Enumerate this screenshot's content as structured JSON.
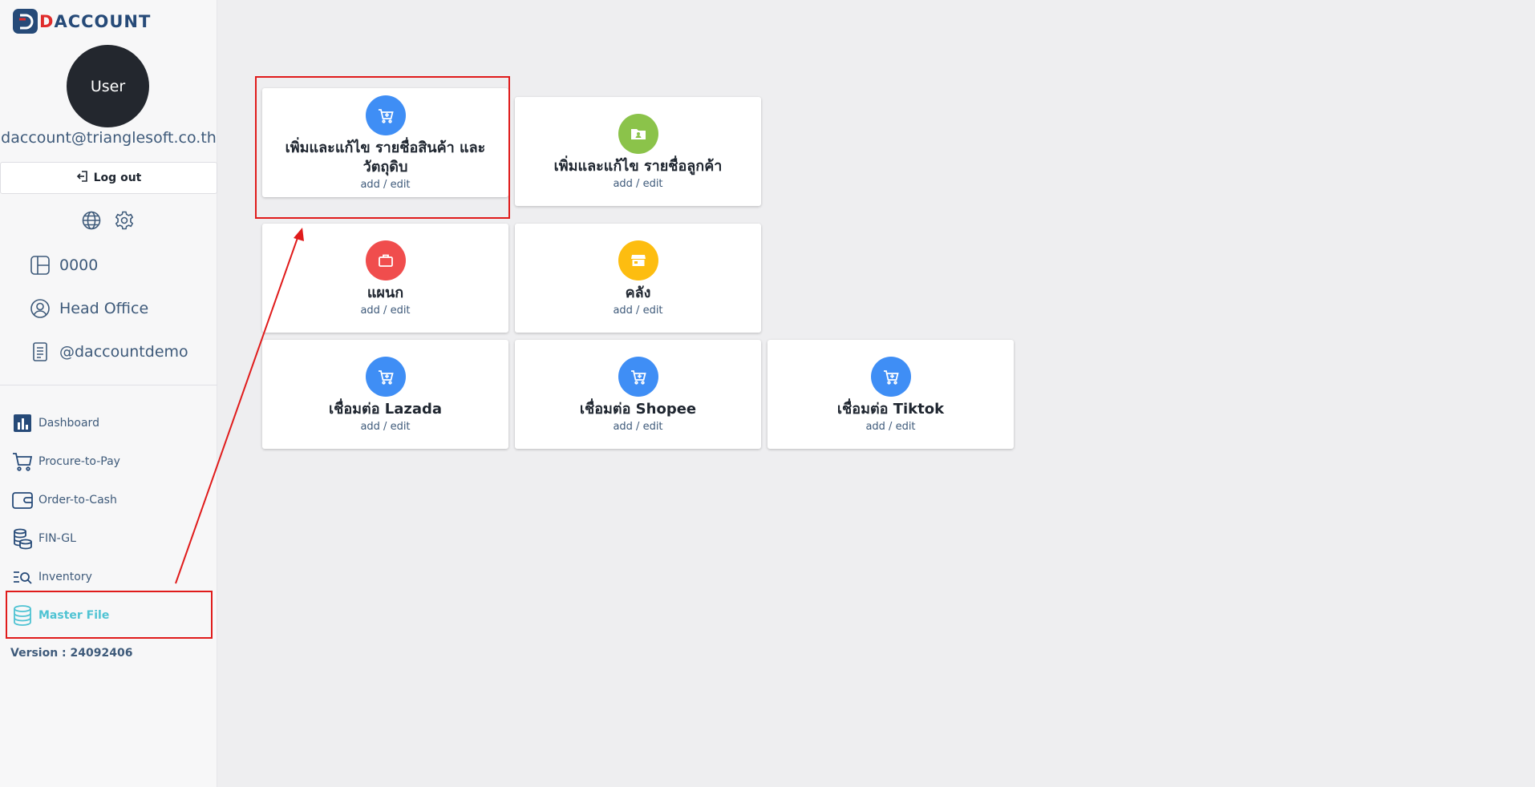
{
  "app": {
    "logo_text_first": "D",
    "logo_text_rest": "ACCOUNT",
    "brand_color": "#264a78",
    "logo_accent_color": "#e02c2c"
  },
  "user": {
    "avatar_label": "User",
    "email": "daccount@trianglesoft.co.th",
    "logout_label": "Log out"
  },
  "info": {
    "company_code": "0000",
    "branch": "Head Office",
    "account": "@daccountdemo"
  },
  "nav": {
    "items": [
      {
        "label": "Dashboard",
        "icon": "bar-chart-icon"
      },
      {
        "label": "Procure-to-Pay",
        "icon": "cart-icon"
      },
      {
        "label": "Order-to-Cash",
        "icon": "wallet-icon"
      },
      {
        "label": "FIN-GL",
        "icon": "coins-icon"
      },
      {
        "label": "Inventory",
        "icon": "list-search-icon"
      },
      {
        "label": "Master File",
        "icon": "database-icon",
        "active": true
      }
    ],
    "active_color": "#4fc3d3"
  },
  "version_label": "Version : 24092406",
  "cards": [
    {
      "title": "เพิ่มและแก้ไข รายชื่อสินค้า และวัตถุดิบ",
      "sub": "add / edit",
      "icon": "cart-icon",
      "color": "#3f8ef5"
    },
    {
      "title": "เพิ่มและแก้ไข รายชื่อลูกค้า",
      "sub": "add / edit",
      "icon": "folder-user-icon",
      "color": "#8bc34a"
    },
    {
      "title": "แผนก",
      "sub": "add / edit",
      "icon": "briefcase-icon",
      "color": "#f04d4d"
    },
    {
      "title": "คลัง",
      "sub": "add / edit",
      "icon": "store-icon",
      "color": "#fdbd10"
    },
    {
      "title": "เชื่อมต่อ Lazada",
      "sub": "add / edit",
      "icon": "cart-icon",
      "color": "#3f8ef5"
    },
    {
      "title": "เชื่อมต่อ Shopee",
      "sub": "add / edit",
      "icon": "cart-icon",
      "color": "#3f8ef5"
    },
    {
      "title": "เชื่อมต่อ Tiktok",
      "sub": "add / edit",
      "icon": "cart-icon",
      "color": "#3f8ef5"
    }
  ],
  "annotation_color": "#e01b1b"
}
